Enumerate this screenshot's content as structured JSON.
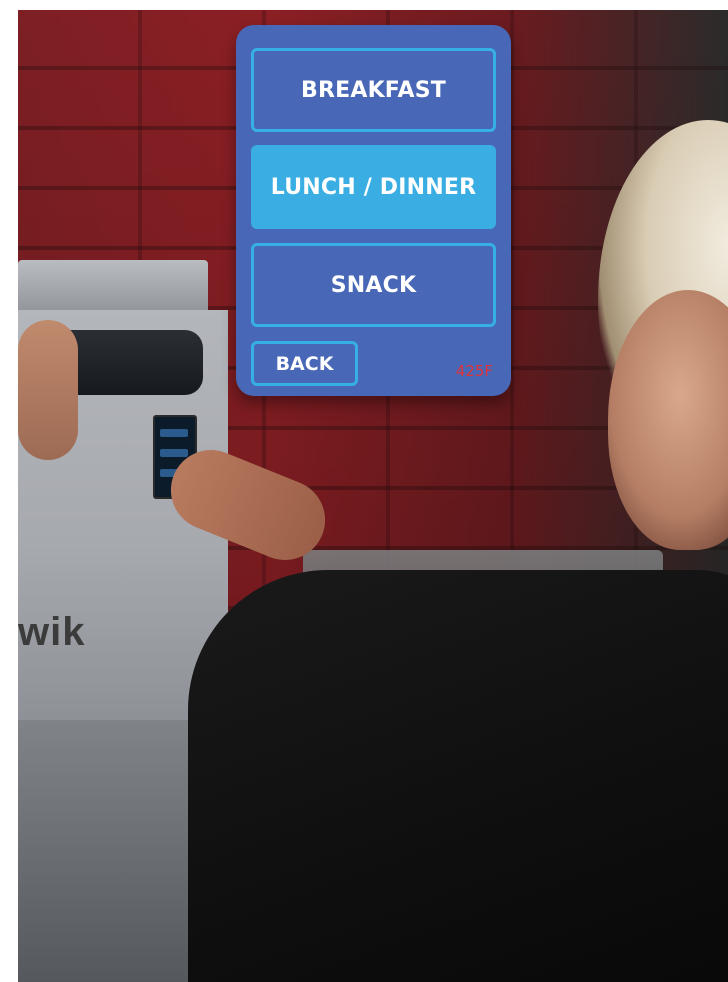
{
  "menu": {
    "breakfast_label": "BREAKFAST",
    "lunch_dinner_label": "LUNCH / DINNER",
    "snack_label": "SNACK",
    "selected": "LUNCH / DINNER"
  },
  "footer": {
    "back_label": "BACK",
    "temperature": "425F"
  },
  "background": {
    "oven_brand_text": "wik"
  },
  "colors": {
    "panel": "#4867b6",
    "button_border": "#36b0e4",
    "selected_button": "#3aaee3",
    "temperature": "#e0353a"
  }
}
